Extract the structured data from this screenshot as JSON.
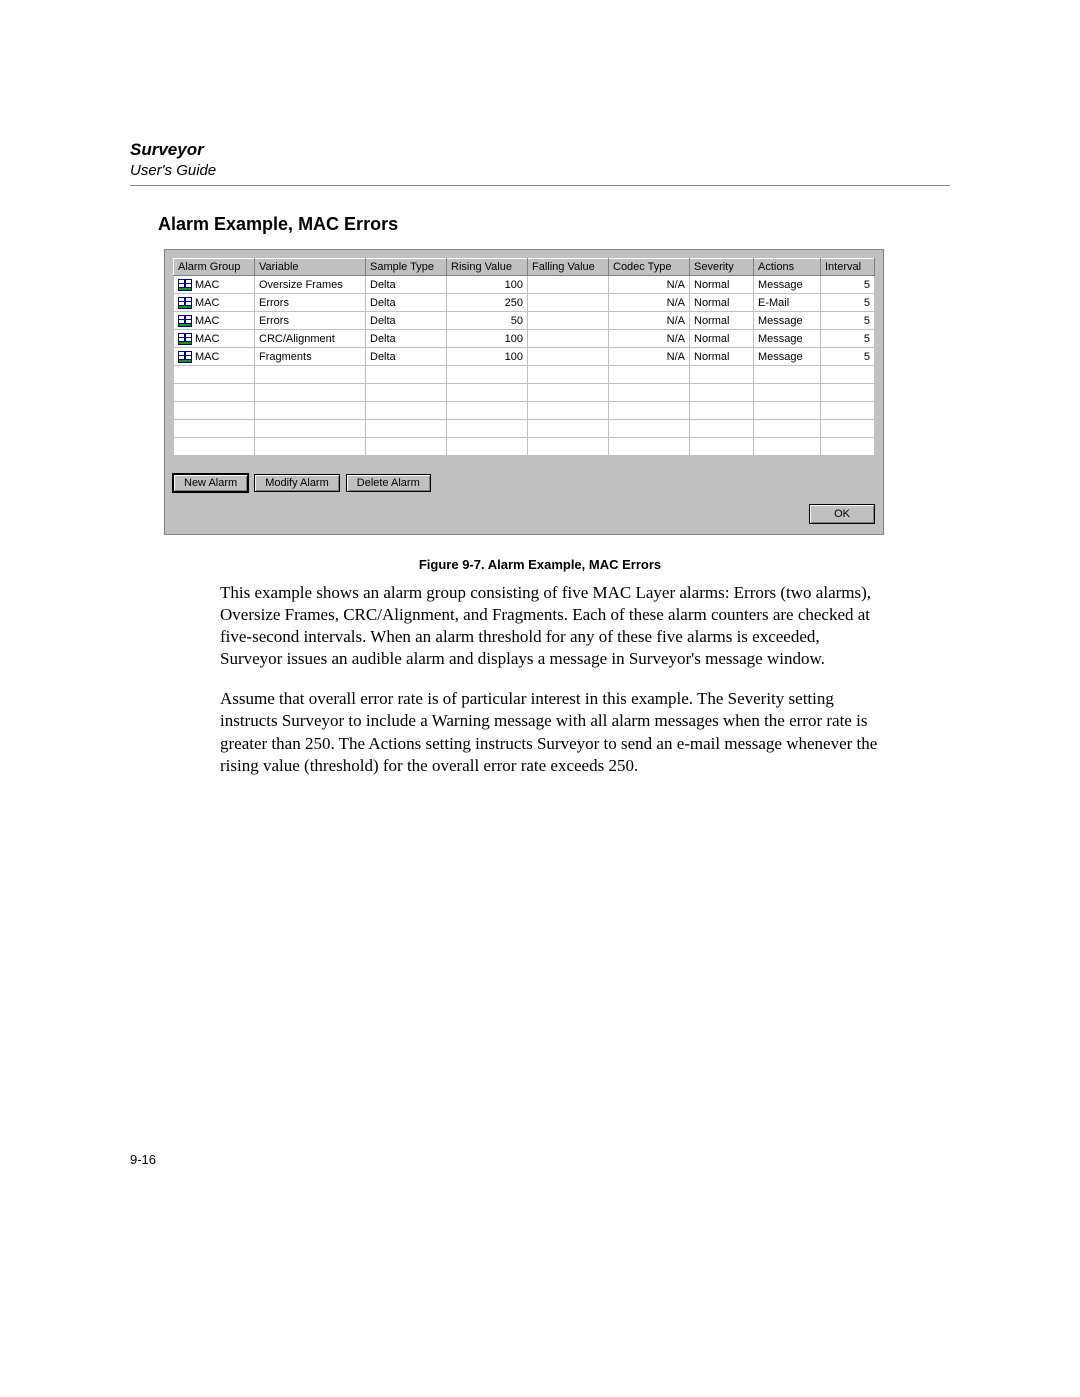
{
  "header": {
    "title": "Surveyor",
    "subtitle": "User's Guide"
  },
  "section_heading": "Alarm Example, MAC Errors",
  "table": {
    "columns": [
      "Alarm Group",
      "Variable",
      "Sample Type",
      "Rising Value",
      "Falling Value",
      "Codec Type",
      "Severity",
      "Actions",
      "Interval"
    ],
    "rows": [
      {
        "group": "MAC",
        "variable": "Oversize Frames",
        "sample": "Delta",
        "rising": "100",
        "falling": "",
        "codec": "N/A",
        "severity": "Normal",
        "actions": "Message",
        "interval": "5"
      },
      {
        "group": "MAC",
        "variable": "Errors",
        "sample": "Delta",
        "rising": "250",
        "falling": "",
        "codec": "N/A",
        "severity": "Normal",
        "actions": "E-Mail",
        "interval": "5"
      },
      {
        "group": "MAC",
        "variable": "Errors",
        "sample": "Delta",
        "rising": "50",
        "falling": "",
        "codec": "N/A",
        "severity": "Normal",
        "actions": "Message",
        "interval": "5"
      },
      {
        "group": "MAC",
        "variable": "CRC/Alignment",
        "sample": "Delta",
        "rising": "100",
        "falling": "",
        "codec": "N/A",
        "severity": "Normal",
        "actions": "Message",
        "interval": "5"
      },
      {
        "group": "MAC",
        "variable": "Fragments",
        "sample": "Delta",
        "rising": "100",
        "falling": "",
        "codec": "N/A",
        "severity": "Normal",
        "actions": "Message",
        "interval": "5"
      }
    ],
    "empty_rows": 5
  },
  "buttons": {
    "new_alarm": "New Alarm",
    "modify_alarm": "Modify Alarm",
    "delete_alarm": "Delete Alarm",
    "ok": "OK"
  },
  "figure_caption": "Figure 9-7.  Alarm Example, MAC Errors",
  "paragraphs": [
    "This example shows an alarm group consisting of five MAC Layer alarms: Errors (two alarms), Oversize Frames, CRC/Alignment, and Fragments. Each of these alarm counters are checked at five-second intervals. When an alarm threshold for any of these five alarms is exceeded, Surveyor issues an audible alarm and displays a message in Surveyor's message window.",
    "Assume that overall error rate is of particular interest in this example. The Severity setting instructs Surveyor to include a Warning message with all alarm messages when the error rate is greater than 250. The Actions setting instructs Surveyor to send an e-mail message whenever the rising value (threshold) for the overall error rate exceeds 250."
  ],
  "page_number": "9-16"
}
